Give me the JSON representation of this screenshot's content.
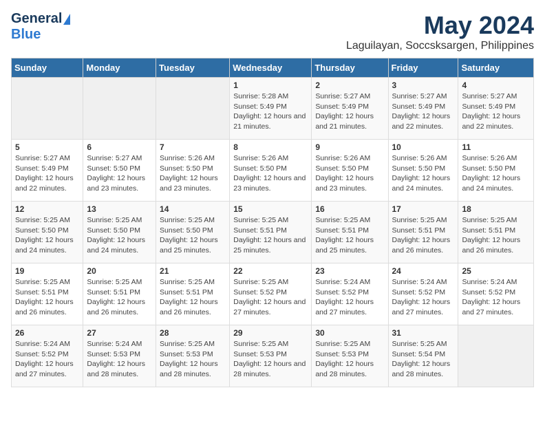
{
  "logo": {
    "general": "General",
    "blue": "Blue"
  },
  "title": "May 2024",
  "subtitle": "Laguilayan, Soccsksargen, Philippines",
  "headers": [
    "Sunday",
    "Monday",
    "Tuesday",
    "Wednesday",
    "Thursday",
    "Friday",
    "Saturday"
  ],
  "weeks": [
    [
      {
        "day": "",
        "sunrise": "",
        "sunset": "",
        "daylight": ""
      },
      {
        "day": "",
        "sunrise": "",
        "sunset": "",
        "daylight": ""
      },
      {
        "day": "",
        "sunrise": "",
        "sunset": "",
        "daylight": ""
      },
      {
        "day": "1",
        "sunrise": "Sunrise: 5:28 AM",
        "sunset": "Sunset: 5:49 PM",
        "daylight": "Daylight: 12 hours and 21 minutes."
      },
      {
        "day": "2",
        "sunrise": "Sunrise: 5:27 AM",
        "sunset": "Sunset: 5:49 PM",
        "daylight": "Daylight: 12 hours and 21 minutes."
      },
      {
        "day": "3",
        "sunrise": "Sunrise: 5:27 AM",
        "sunset": "Sunset: 5:49 PM",
        "daylight": "Daylight: 12 hours and 22 minutes."
      },
      {
        "day": "4",
        "sunrise": "Sunrise: 5:27 AM",
        "sunset": "Sunset: 5:49 PM",
        "daylight": "Daylight: 12 hours and 22 minutes."
      }
    ],
    [
      {
        "day": "5",
        "sunrise": "Sunrise: 5:27 AM",
        "sunset": "Sunset: 5:49 PM",
        "daylight": "Daylight: 12 hours and 22 minutes."
      },
      {
        "day": "6",
        "sunrise": "Sunrise: 5:27 AM",
        "sunset": "Sunset: 5:50 PM",
        "daylight": "Daylight: 12 hours and 23 minutes."
      },
      {
        "day": "7",
        "sunrise": "Sunrise: 5:26 AM",
        "sunset": "Sunset: 5:50 PM",
        "daylight": "Daylight: 12 hours and 23 minutes."
      },
      {
        "day": "8",
        "sunrise": "Sunrise: 5:26 AM",
        "sunset": "Sunset: 5:50 PM",
        "daylight": "Daylight: 12 hours and 23 minutes."
      },
      {
        "day": "9",
        "sunrise": "Sunrise: 5:26 AM",
        "sunset": "Sunset: 5:50 PM",
        "daylight": "Daylight: 12 hours and 23 minutes."
      },
      {
        "day": "10",
        "sunrise": "Sunrise: 5:26 AM",
        "sunset": "Sunset: 5:50 PM",
        "daylight": "Daylight: 12 hours and 24 minutes."
      },
      {
        "day": "11",
        "sunrise": "Sunrise: 5:26 AM",
        "sunset": "Sunset: 5:50 PM",
        "daylight": "Daylight: 12 hours and 24 minutes."
      }
    ],
    [
      {
        "day": "12",
        "sunrise": "Sunrise: 5:25 AM",
        "sunset": "Sunset: 5:50 PM",
        "daylight": "Daylight: 12 hours and 24 minutes."
      },
      {
        "day": "13",
        "sunrise": "Sunrise: 5:25 AM",
        "sunset": "Sunset: 5:50 PM",
        "daylight": "Daylight: 12 hours and 24 minutes."
      },
      {
        "day": "14",
        "sunrise": "Sunrise: 5:25 AM",
        "sunset": "Sunset: 5:50 PM",
        "daylight": "Daylight: 12 hours and 25 minutes."
      },
      {
        "day": "15",
        "sunrise": "Sunrise: 5:25 AM",
        "sunset": "Sunset: 5:51 PM",
        "daylight": "Daylight: 12 hours and 25 minutes."
      },
      {
        "day": "16",
        "sunrise": "Sunrise: 5:25 AM",
        "sunset": "Sunset: 5:51 PM",
        "daylight": "Daylight: 12 hours and 25 minutes."
      },
      {
        "day": "17",
        "sunrise": "Sunrise: 5:25 AM",
        "sunset": "Sunset: 5:51 PM",
        "daylight": "Daylight: 12 hours and 26 minutes."
      },
      {
        "day": "18",
        "sunrise": "Sunrise: 5:25 AM",
        "sunset": "Sunset: 5:51 PM",
        "daylight": "Daylight: 12 hours and 26 minutes."
      }
    ],
    [
      {
        "day": "19",
        "sunrise": "Sunrise: 5:25 AM",
        "sunset": "Sunset: 5:51 PM",
        "daylight": "Daylight: 12 hours and 26 minutes."
      },
      {
        "day": "20",
        "sunrise": "Sunrise: 5:25 AM",
        "sunset": "Sunset: 5:51 PM",
        "daylight": "Daylight: 12 hours and 26 minutes."
      },
      {
        "day": "21",
        "sunrise": "Sunrise: 5:25 AM",
        "sunset": "Sunset: 5:51 PM",
        "daylight": "Daylight: 12 hours and 26 minutes."
      },
      {
        "day": "22",
        "sunrise": "Sunrise: 5:25 AM",
        "sunset": "Sunset: 5:52 PM",
        "daylight": "Daylight: 12 hours and 27 minutes."
      },
      {
        "day": "23",
        "sunrise": "Sunrise: 5:24 AM",
        "sunset": "Sunset: 5:52 PM",
        "daylight": "Daylight: 12 hours and 27 minutes."
      },
      {
        "day": "24",
        "sunrise": "Sunrise: 5:24 AM",
        "sunset": "Sunset: 5:52 PM",
        "daylight": "Daylight: 12 hours and 27 minutes."
      },
      {
        "day": "25",
        "sunrise": "Sunrise: 5:24 AM",
        "sunset": "Sunset: 5:52 PM",
        "daylight": "Daylight: 12 hours and 27 minutes."
      }
    ],
    [
      {
        "day": "26",
        "sunrise": "Sunrise: 5:24 AM",
        "sunset": "Sunset: 5:52 PM",
        "daylight": "Daylight: 12 hours and 27 minutes."
      },
      {
        "day": "27",
        "sunrise": "Sunrise: 5:24 AM",
        "sunset": "Sunset: 5:53 PM",
        "daylight": "Daylight: 12 hours and 28 minutes."
      },
      {
        "day": "28",
        "sunrise": "Sunrise: 5:25 AM",
        "sunset": "Sunset: 5:53 PM",
        "daylight": "Daylight: 12 hours and 28 minutes."
      },
      {
        "day": "29",
        "sunrise": "Sunrise: 5:25 AM",
        "sunset": "Sunset: 5:53 PM",
        "daylight": "Daylight: 12 hours and 28 minutes."
      },
      {
        "day": "30",
        "sunrise": "Sunrise: 5:25 AM",
        "sunset": "Sunset: 5:53 PM",
        "daylight": "Daylight: 12 hours and 28 minutes."
      },
      {
        "day": "31",
        "sunrise": "Sunrise: 5:25 AM",
        "sunset": "Sunset: 5:54 PM",
        "daylight": "Daylight: 12 hours and 28 minutes."
      },
      {
        "day": "",
        "sunrise": "",
        "sunset": "",
        "daylight": ""
      }
    ]
  ],
  "colors": {
    "header_bg": "#2e6da4",
    "header_text": "#ffffff",
    "title_color": "#1a3a5c",
    "odd_row": "#f9f9f9",
    "even_row": "#ffffff",
    "empty_cell": "#f0f0f0"
  }
}
